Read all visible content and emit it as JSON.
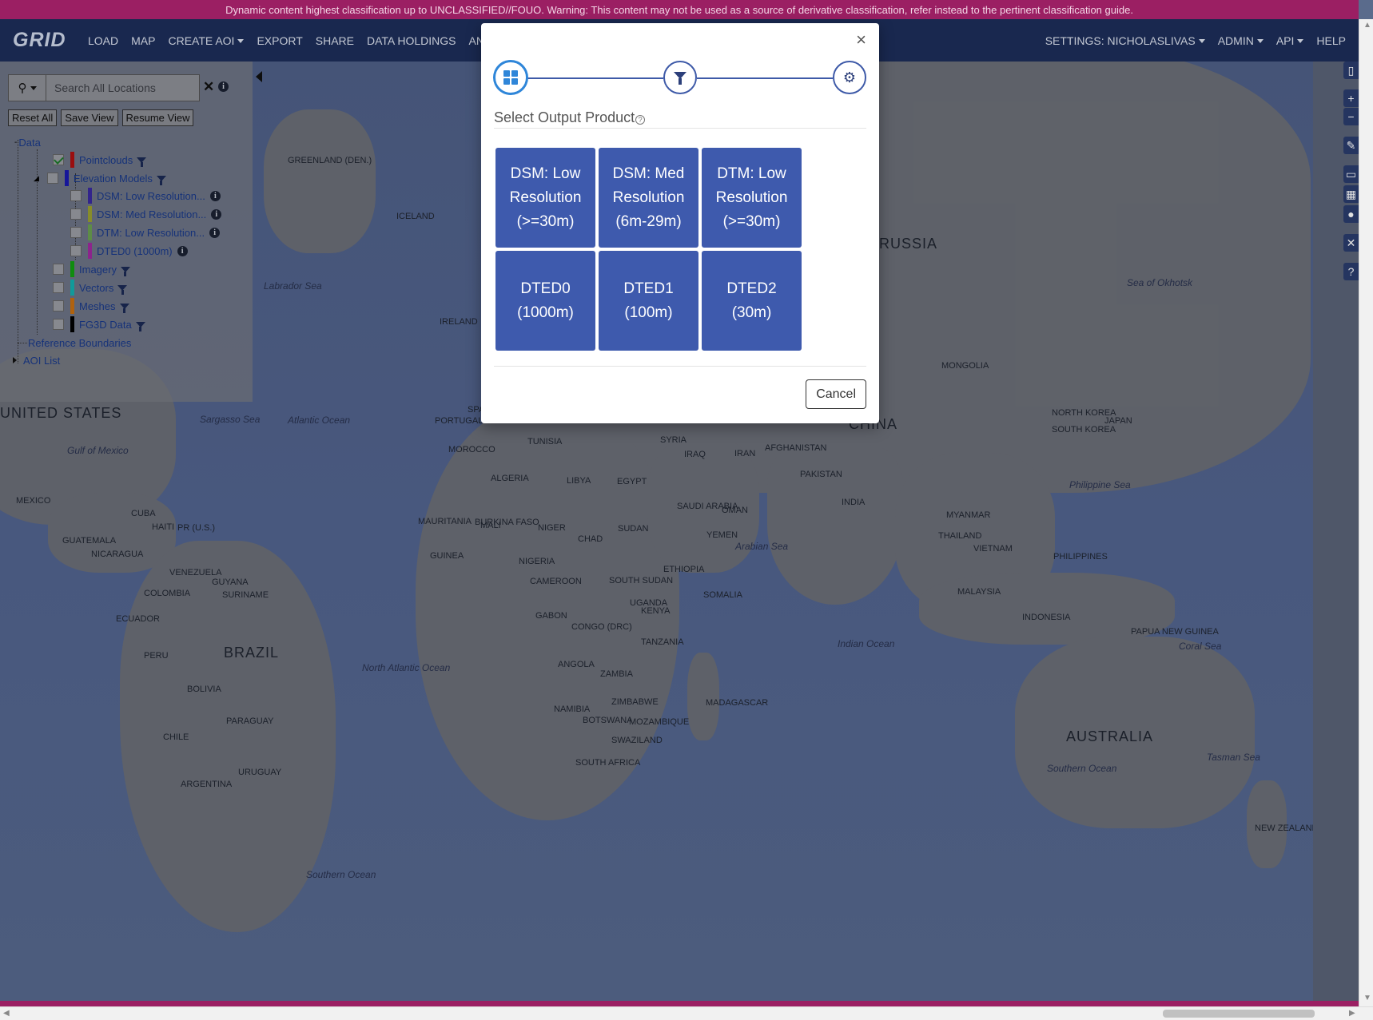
{
  "classification_banner": "Dynamic content highest classification up to UNCLASSIFIED//FOUO. Warning: This content may not be used as a source of derivative classification, refer instead to the pertinent classification guide.",
  "navbar": {
    "logo": "GRID",
    "left_items": [
      "LOAD",
      "MAP",
      "CREATE AOI",
      "EXPORT",
      "SHARE",
      "DATA HOLDINGS",
      "ANALYT"
    ],
    "right_items": [
      "SETTINGS: NICHOLASLIVAS",
      "ADMIN",
      "API",
      "HELP"
    ]
  },
  "sidebar": {
    "search_placeholder": "Search All Locations",
    "buttons": [
      "Reset All",
      "Save View",
      "Resume View"
    ],
    "tree": {
      "root": "Data",
      "layers": [
        {
          "label": "Pointclouds",
          "checked": true,
          "color": "#b01010"
        },
        {
          "label": "Elevation Models",
          "checked": false,
          "color": "#1a1ab0"
        },
        {
          "label": "Imagery",
          "checked": false,
          "color": "#12a012"
        },
        {
          "label": "Vectors",
          "checked": false,
          "color": "#14b0b0"
        },
        {
          "label": "Meshes",
          "checked": false,
          "color": "#c87010"
        },
        {
          "label": "FG3D Data",
          "checked": false,
          "color": "#000000"
        }
      ],
      "elevation_children": [
        {
          "label": "DSM: Low Resolution...",
          "color": "#3a2aa0"
        },
        {
          "label": "DSM: Med Resolution...",
          "color": "#9aa030"
        },
        {
          "label": "DTM: Low Resolution...",
          "color": "#6aa050"
        },
        {
          "label": "DTED0 (1000m)",
          "color": "#a02aa0"
        }
      ],
      "reference": "Reference Boundaries",
      "aoi_list": "AOI List"
    }
  },
  "modal": {
    "title": "Select Output Product",
    "help": "?",
    "close": "×",
    "products": [
      "DSM: Low Resolution (>=30m)",
      "DSM: Med Resolution (6m-29m)",
      "DTM: Low Resolution (>=30m)",
      "DTED0 (1000m)",
      "DTED1 (100m)",
      "DTED2 (30m)"
    ],
    "cancel": "Cancel"
  },
  "map_labels": {
    "countries": [
      "GREENLAND (DEN.)",
      "ICELAND",
      "RUSSIA",
      "CHINA",
      "MONGOLIA",
      "NORTH KOREA",
      "SOUTH KOREA",
      "JAPAN",
      "IRELAND",
      "PORTUGAL",
      "SPAIN",
      "MOROCCO",
      "ALGERIA",
      "TUNISIA",
      "LIBYA",
      "EGYPT",
      "SYRIA",
      "IRAQ",
      "IRAN",
      "AFGHANISTAN",
      "PAKISTAN",
      "INDIA",
      "SAUDI ARABIA",
      "OMAN",
      "YEMEN",
      "MAURITANIA",
      "MALI",
      "NIGER",
      "CHAD",
      "SUDAN",
      "BURKINA FASO",
      "GUINEA",
      "NIGERIA",
      "CAMEROON",
      "GABON",
      "SOUTH SUDAN",
      "ETHIOPIA",
      "SOMALIA",
      "UGANDA",
      "KENYA",
      "CONGO (DRC)",
      "TANZANIA",
      "ANGOLA",
      "ZAMBIA",
      "ZIMBABWE",
      "NAMIBIA",
      "BOTSWANA",
      "MOZAMBIQUE",
      "MADAGASCAR",
      "SWAZILAND",
      "SOUTH AFRICA",
      "MYANMAR",
      "THAILAND",
      "VIETNAM",
      "PHILIPPINES",
      "MALAYSIA",
      "INDONESIA",
      "PAPUA NEW GUINEA",
      "AUSTRALIA",
      "NEW ZEALAND",
      "UNITED STATES",
      "MEXICO",
      "CUBA",
      "HAITI",
      "PR (U.S.)",
      "GUATEMALA",
      "NICARAGUA",
      "VENEZUELA",
      "GUYANA",
      "SURINAME",
      "COLOMBIA",
      "ECUADOR",
      "PERU",
      "BRAZIL",
      "BOLIVIA",
      "PARAGUAY",
      "CHILE",
      "URUGUAY",
      "ARGENTINA"
    ],
    "oceans": [
      "Labrador Sea",
      "Sargasso Sea",
      "Atlantic Ocean",
      "Gulf of Mexico",
      "North Atlantic Ocean",
      "Arabian Sea",
      "Indian Ocean",
      "Sea of Okhotsk",
      "Philippine Sea",
      "Coral Sea",
      "Tasman Sea",
      "Southern Ocean",
      "Southern Ocean"
    ]
  }
}
